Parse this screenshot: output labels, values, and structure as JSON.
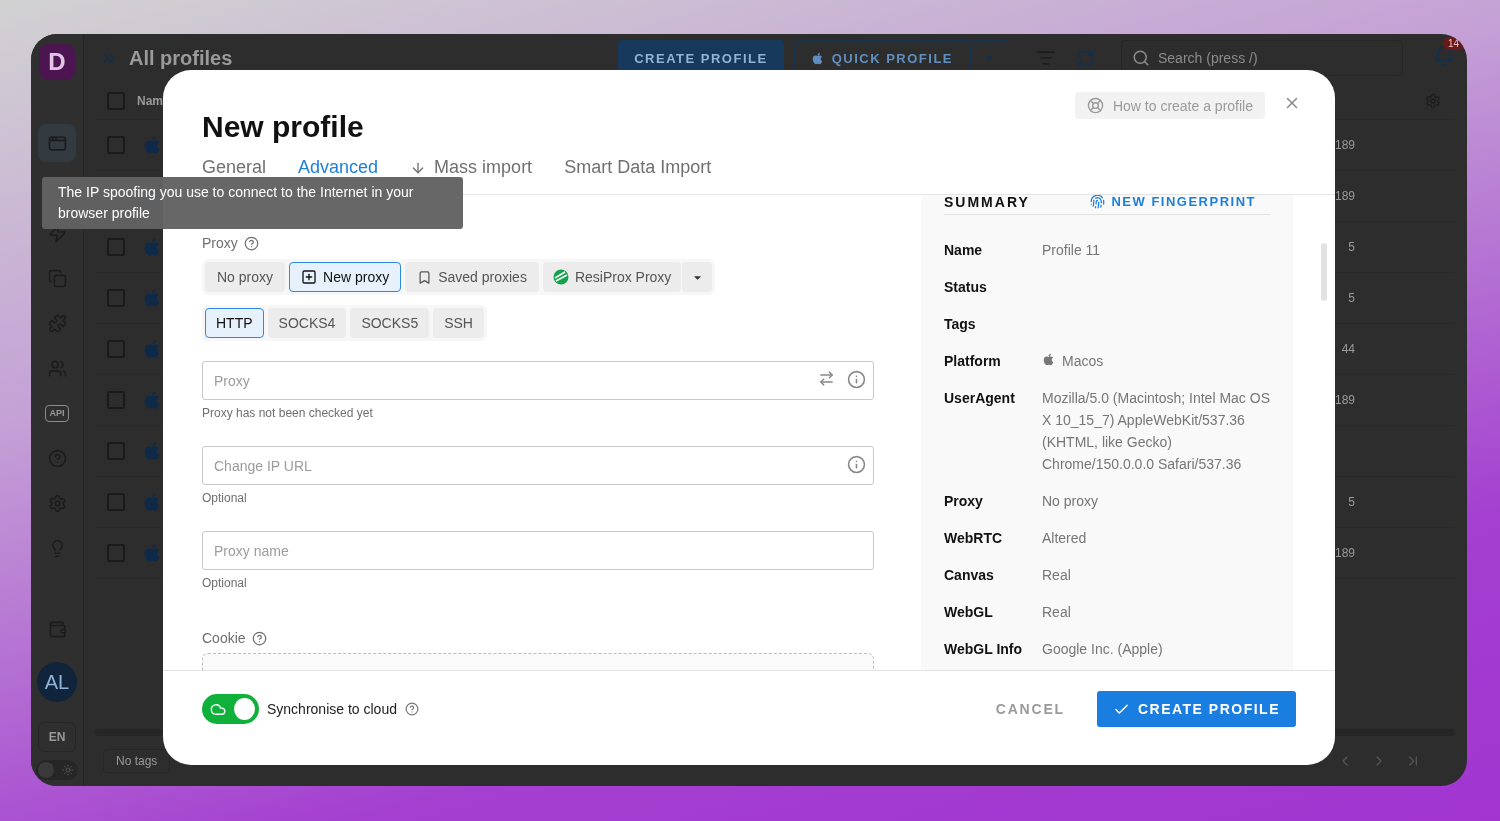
{
  "app": {
    "logo": "D",
    "page_title": "All profiles",
    "create_button": "CREATE PROFILE",
    "quick_profile_button": "QUICK PROFILE",
    "search": {
      "placeholder": "Search (press /)"
    },
    "notifications_count": "14",
    "sidebar": {
      "items": [
        {
          "selected": true
        },
        {
          "selected": false
        },
        {
          "selected": false
        },
        {
          "selected": false
        },
        {
          "selected": false
        },
        {
          "selected": false,
          "label": "API"
        },
        {
          "selected": false
        },
        {
          "selected": false
        },
        {
          "selected": false
        }
      ],
      "avatar": "AL",
      "language": "EN",
      "theme_toggle": {
        "on": false
      }
    },
    "table": {
      "column_1": "Nam",
      "all_checked": false,
      "rows": [
        {
          "checked": false,
          "value": "189"
        },
        {
          "value": "189"
        },
        {
          "checked": false,
          "value": "5"
        },
        {
          "checked": false,
          "value": "5"
        },
        {
          "checked": false,
          "value": "44"
        },
        {
          "checked": false,
          "value": "189"
        },
        {
          "checked": false
        },
        {
          "checked": false,
          "value": "5"
        },
        {
          "checked": false,
          "value": "189"
        }
      ]
    },
    "tag_filter": "No tags"
  },
  "modal": {
    "title": "New profile",
    "help_button": "How to create a profile",
    "tabs": [
      {
        "label": "General",
        "selected": false
      },
      {
        "label": "Advanced",
        "selected": true
      },
      {
        "label": "Mass import",
        "selected": false,
        "kind": "download"
      },
      {
        "label": "Smart Data Import",
        "selected": false
      }
    ],
    "tooltip": "The IP spoofing you use to connect to the Internet in your browser profile",
    "proxy": {
      "label": "Proxy",
      "modes": [
        {
          "label": "No proxy",
          "selected": false,
          "kind": "plain"
        },
        {
          "label": "New proxy",
          "selected": true,
          "kind": "new"
        },
        {
          "label": "Saved proxies",
          "selected": false,
          "kind": "saved"
        },
        {
          "label": "ResiProx Proxy",
          "selected": false,
          "kind": "provider"
        }
      ],
      "protocols": [
        {
          "label": "HTTP",
          "selected": true
        },
        {
          "label": "SOCKS4",
          "selected": false
        },
        {
          "label": "SOCKS5",
          "selected": false
        },
        {
          "label": "SSH",
          "selected": false
        }
      ],
      "fields": [
        {
          "placeholder": "Proxy",
          "hint": "Proxy has not been checked yet",
          "kind": "proxy"
        },
        {
          "placeholder": "Change IP URL",
          "hint": "Optional",
          "kind": "url"
        },
        {
          "placeholder": "Proxy name",
          "hint": "Optional",
          "kind": "plain"
        }
      ]
    },
    "cookie": {
      "label": "Cookie"
    },
    "summary": {
      "title": "SUMMARY",
      "action": "NEW FINGERPRINT",
      "rows": [
        {
          "label": "Name",
          "value": "Profile 11"
        },
        {
          "label": "Status"
        },
        {
          "label": "Tags"
        },
        {
          "label": "Platform",
          "value": "Macos",
          "kind": "platform"
        },
        {
          "label": "UserAgent",
          "value": "Mozilla/5.0 (Macintosh; Intel Mac OS X 10_15_7) AppleWebKit/537.36 (KHTML, like Gecko) Chrome/150.0.0.0 Safari/537.36"
        },
        {
          "label": "Proxy",
          "value": "No proxy"
        },
        {
          "label": "WebRTC",
          "value": "Altered"
        },
        {
          "label": "Canvas",
          "value": "Real"
        },
        {
          "label": "WebGL",
          "value": "Real"
        },
        {
          "label": "WebGL Info",
          "value": "Google Inc. (Apple)"
        }
      ]
    },
    "footer": {
      "sync": {
        "label": "Synchronise to cloud",
        "on": true
      },
      "cancel": "CANCEL",
      "submit": "CREATE PROFILE"
    }
  }
}
